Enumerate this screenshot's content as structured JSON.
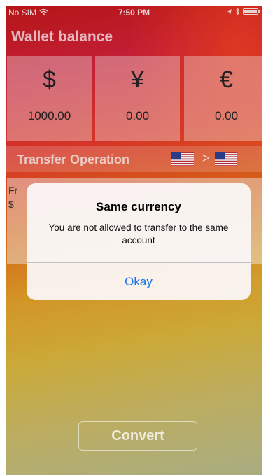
{
  "status_bar": {
    "carrier": "No SIM",
    "time": "7:50 PM",
    "icons": [
      "wifi-icon",
      "location-icon",
      "bluetooth-icon",
      "battery-icon"
    ]
  },
  "wallet": {
    "title": "Wallet balance",
    "balances": [
      {
        "symbol": "$",
        "amount": "1000.00"
      },
      {
        "symbol": "¥",
        "amount": "0.00"
      },
      {
        "symbol": "€",
        "amount": "0.00"
      }
    ]
  },
  "transfer": {
    "title": "Transfer Operation",
    "from_flag": "us-flag-icon",
    "separator": ">",
    "to_flag": "us-flag-icon",
    "from_label": "Fr",
    "from_currency": "$"
  },
  "alert": {
    "title": "Same currency",
    "message": "You are not allowed to transfer to the same account",
    "button": "Okay"
  },
  "convert_button": "Convert",
  "colors": {
    "alert_button": "#1a73e8",
    "background_top": "#c01818",
    "background_bottom": "#b4b88a"
  }
}
